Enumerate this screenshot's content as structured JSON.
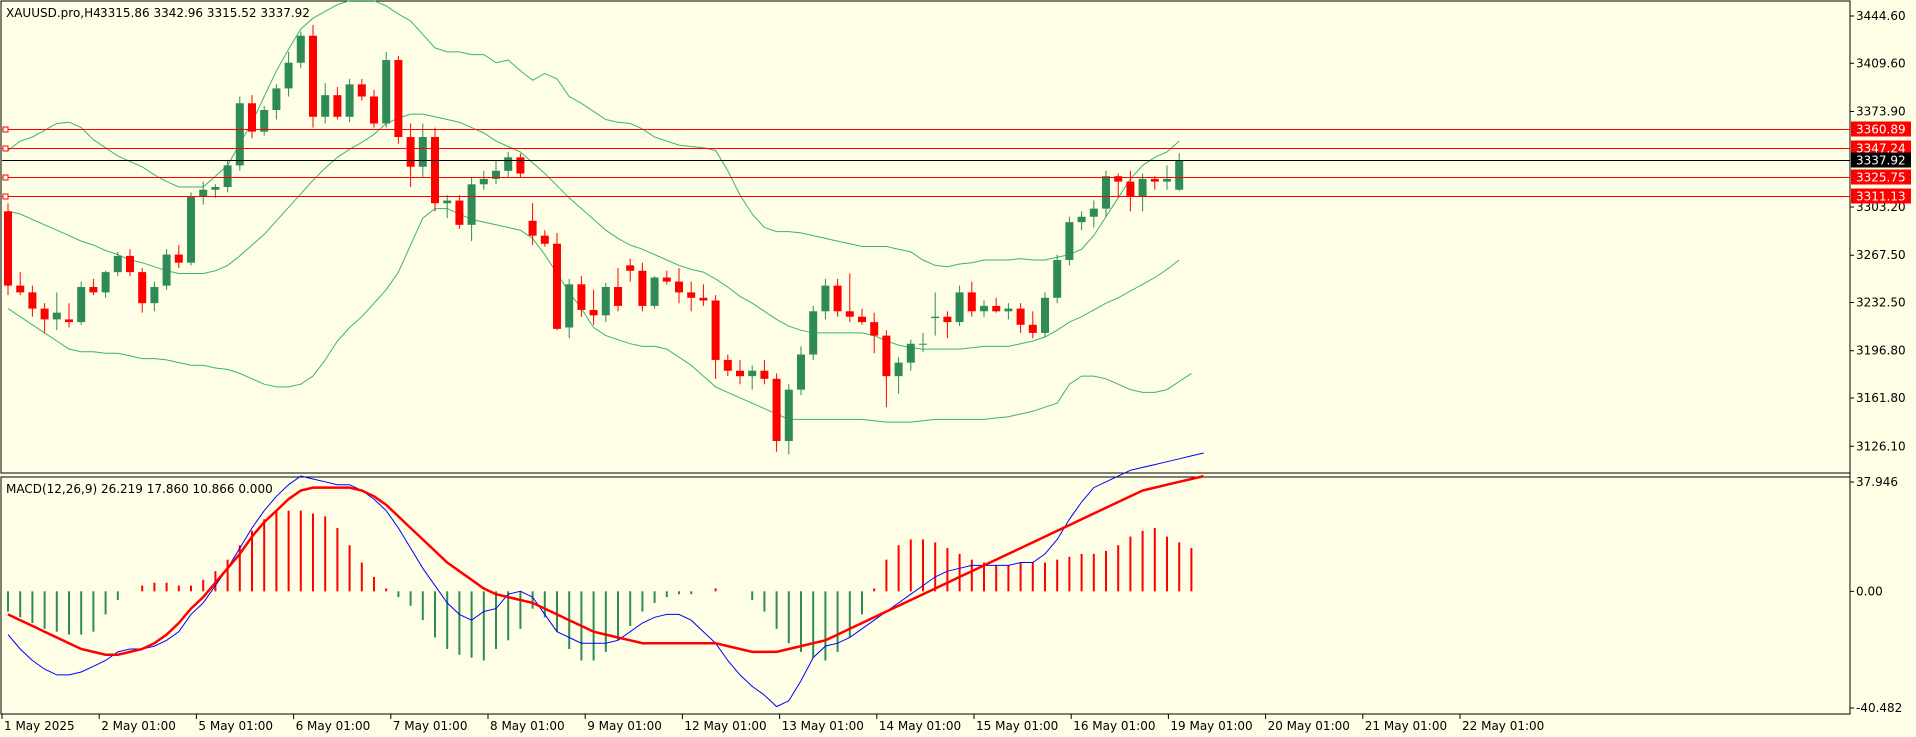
{
  "header": {
    "symbol": "XAUUSD.pro,H4",
    "ohlc": "3315.86 3342.96 3315.52 3337.92"
  },
  "macd_header": "MACD(12,26,9) 26.219 17.860 10.866 0.000",
  "colors": {
    "background": "#fefee6",
    "bull": "#2e8b57",
    "bear": "#ff0000",
    "bollinger": "#3cb371",
    "level": "#ff0000",
    "current": "#000000",
    "macd_line": "#0000ff",
    "signal_line": "#ff0000"
  },
  "chart_data": [
    {
      "type": "candlestick",
      "name": "XAUUSD.pro,H4",
      "ylim": [
        3110,
        3452
      ],
      "price_ticks": [
        "3444.60",
        "3409.60",
        "3373.90",
        "3303.20",
        "3267.50",
        "3232.50",
        "3196.80",
        "3161.80",
        "3126.10"
      ],
      "level_lines": [
        {
          "value": 3360.89,
          "label": "3360.89",
          "color": "#ff0000"
        },
        {
          "value": 3347.24,
          "label": "3347.24",
          "color": "#ff0000"
        },
        {
          "value": 3337.92,
          "label": "3337.92",
          "color": "#000000"
        },
        {
          "value": 3325.75,
          "label": "3325.75",
          "color": "#ff0000"
        },
        {
          "value": 3311.13,
          "label": "3311.13",
          "color": "#ff0000"
        }
      ],
      "x_labels": [
        "1 May 2025",
        "2 May 01:00",
        "5 May 01:00",
        "6 May 01:00",
        "7 May 01:00",
        "8 May 01:00",
        "9 May 01:00",
        "12 May 01:00",
        "13 May 01:00",
        "14 May 01:00",
        "15 May 01:00",
        "16 May 01:00",
        "19 May 01:00",
        "20 May 01:00",
        "21 May 01:00",
        "22 May 01:00"
      ],
      "candles": [
        [
          3300,
          3306,
          3238,
          3245
        ],
        [
          3245,
          3255,
          3238,
          3240
        ],
        [
          3240,
          3245,
          3222,
          3228
        ],
        [
          3228,
          3232,
          3210,
          3220
        ],
        [
          3220,
          3240,
          3212,
          3225
        ],
        [
          3220,
          3232,
          3214,
          3218
        ],
        [
          3218,
          3248,
          3216,
          3244
        ],
        [
          3244,
          3250,
          3238,
          3240
        ],
        [
          3240,
          3256,
          3236,
          3255
        ],
        [
          3255,
          3270,
          3252,
          3267
        ],
        [
          3267,
          3272,
          3252,
          3255
        ],
        [
          3255,
          3258,
          3225,
          3232
        ],
        [
          3232,
          3248,
          3226,
          3244
        ],
        [
          3245,
          3272,
          3242,
          3268
        ],
        [
          3268,
          3275,
          3258,
          3262
        ],
        [
          3262,
          3314,
          3260,
          3311
        ],
        [
          3311,
          3322,
          3305,
          3316
        ],
        [
          3316,
          3320,
          3310,
          3318
        ],
        [
          3318,
          3338,
          3314,
          3334
        ],
        [
          3334,
          3385,
          3330,
          3380
        ],
        [
          3380,
          3386,
          3354,
          3359
        ],
        [
          3359,
          3378,
          3356,
          3375
        ],
        [
          3375,
          3394,
          3368,
          3391
        ],
        [
          3391,
          3418,
          3385,
          3410
        ],
        [
          3410,
          3433,
          3406,
          3430
        ],
        [
          3430,
          3438,
          3362,
          3370
        ],
        [
          3370,
          3395,
          3365,
          3386
        ],
        [
          3386,
          3392,
          3368,
          3370
        ],
        [
          3370,
          3398,
          3366,
          3394
        ],
        [
          3394,
          3398,
          3382,
          3385
        ],
        [
          3385,
          3390,
          3362,
          3365
        ],
        [
          3365,
          3418,
          3362,
          3412
        ],
        [
          3412,
          3415,
          3350,
          3355
        ],
        [
          3355,
          3365,
          3318,
          3333
        ],
        [
          3333,
          3365,
          3325,
          3355
        ],
        [
          3355,
          3362,
          3300,
          3306
        ],
        [
          3306,
          3312,
          3295,
          3308
        ],
        [
          3308,
          3312,
          3287,
          3290
        ],
        [
          3290,
          3325,
          3278,
          3320
        ],
        [
          3320,
          3330,
          3316,
          3324
        ],
        [
          3324,
          3338,
          3320,
          3330
        ],
        [
          3330,
          3344,
          3325,
          3340
        ],
        [
          3340,
          3343,
          3325,
          3328
        ],
        [
          3293,
          3306,
          3275,
          3282
        ],
        [
          3282,
          3286,
          3274,
          3276
        ],
        [
          3276,
          3284,
          3212,
          3213
        ],
        [
          3214,
          3250,
          3206,
          3246
        ],
        [
          3246,
          3252,
          3222,
          3227
        ],
        [
          3227,
          3242,
          3216,
          3223
        ],
        [
          3223,
          3247,
          3218,
          3244
        ],
        [
          3244,
          3258,
          3226,
          3230
        ],
        [
          3260,
          3265,
          3248,
          3256
        ],
        [
          3256,
          3262,
          3226,
          3230
        ],
        [
          3230,
          3252,
          3228,
          3251
        ],
        [
          3251,
          3256,
          3246,
          3248
        ],
        [
          3248,
          3258,
          3232,
          3240
        ],
        [
          3240,
          3248,
          3226,
          3236
        ],
        [
          3236,
          3246,
          3230,
          3234
        ],
        [
          3234,
          3238,
          3176,
          3190
        ],
        [
          3190,
          3194,
          3178,
          3182
        ],
        [
          3182,
          3190,
          3172,
          3178
        ],
        [
          3178,
          3186,
          3168,
          3182
        ],
        [
          3182,
          3190,
          3172,
          3176
        ],
        [
          3176,
          3180,
          3122,
          3130
        ],
        [
          3130,
          3172,
          3120,
          3168
        ],
        [
          3168,
          3200,
          3164,
          3194
        ],
        [
          3194,
          3230,
          3190,
          3226
        ],
        [
          3226,
          3250,
          3220,
          3245
        ],
        [
          3245,
          3250,
          3222,
          3226
        ],
        [
          3226,
          3254,
          3218,
          3222
        ],
        [
          3222,
          3228,
          3216,
          3218
        ],
        [
          3218,
          3225,
          3195,
          3208
        ],
        [
          3208,
          3212,
          3155,
          3178
        ],
        [
          3178,
          3192,
          3165,
          3188
        ],
        [
          3188,
          3205,
          3182,
          3202
        ],
        [
          3202,
          3210,
          3196,
          3202
        ],
        [
          3221,
          3240,
          3208,
          3222
        ],
        [
          3222,
          3226,
          3206,
          3218
        ],
        [
          3218,
          3245,
          3215,
          3240
        ],
        [
          3240,
          3248,
          3222,
          3226
        ],
        [
          3226,
          3234,
          3222,
          3230
        ],
        [
          3230,
          3236,
          3225,
          3226
        ],
        [
          3226,
          3232,
          3220,
          3228
        ],
        [
          3228,
          3232,
          3210,
          3216
        ],
        [
          3216,
          3226,
          3206,
          3210
        ],
        [
          3210,
          3240,
          3207,
          3236
        ],
        [
          3236,
          3268,
          3232,
          3264
        ],
        [
          3264,
          3296,
          3260,
          3292
        ],
        [
          3292,
          3300,
          3286,
          3296
        ],
        [
          3296,
          3308,
          3288,
          3302
        ],
        [
          3302,
          3330,
          3296,
          3326
        ],
        [
          3326,
          3328,
          3310,
          3322
        ],
        [
          3322,
          3330,
          3300,
          3311
        ],
        [
          3311,
          3328,
          3300,
          3324
        ],
        [
          3324,
          3326,
          3316,
          3322
        ],
        [
          3322,
          3334,
          3316,
          3324
        ],
        [
          3316,
          3343,
          3315,
          3338
        ]
      ],
      "bollinger": {
        "upper": [
          3345,
          3352,
          3355,
          3360,
          3365,
          3366,
          3362,
          3353,
          3347,
          3341,
          3337,
          3333,
          3327,
          3322,
          3318,
          3318,
          3318,
          3326,
          3334,
          3350,
          3366,
          3385,
          3404,
          3420,
          3435,
          3443,
          3448,
          3453,
          3456,
          3456,
          3456,
          3452,
          3446,
          3441,
          3431,
          3421,
          3418,
          3418,
          3416,
          3416,
          3410,
          3412,
          3404,
          3397,
          3402,
          3398,
          3385,
          3380,
          3374,
          3368,
          3366,
          3365,
          3361,
          3355,
          3352,
          3349,
          3348,
          3347,
          3345,
          3330,
          3312,
          3298,
          3288,
          3285,
          3285,
          3284,
          3282,
          3280,
          3278,
          3276,
          3274,
          3274,
          3274,
          3272,
          3270,
          3264,
          3260,
          3259,
          3261,
          3262,
          3264,
          3264,
          3264,
          3265,
          3264,
          3264,
          3266,
          3268,
          3272,
          3282,
          3296,
          3310,
          3324,
          3334,
          3340,
          3344,
          3352
        ],
        "middle": [
          3300,
          3298,
          3294,
          3290,
          3286,
          3282,
          3278,
          3275,
          3271,
          3268,
          3264,
          3262,
          3259,
          3256,
          3254,
          3254,
          3254,
          3256,
          3260,
          3267,
          3275,
          3283,
          3293,
          3303,
          3313,
          3323,
          3332,
          3340,
          3346,
          3351,
          3357,
          3365,
          3369,
          3372,
          3372,
          3370,
          3368,
          3366,
          3362,
          3358,
          3352,
          3348,
          3344,
          3336,
          3328,
          3319,
          3310,
          3302,
          3294,
          3286,
          3280,
          3275,
          3272,
          3268,
          3264,
          3260,
          3257,
          3255,
          3250,
          3244,
          3237,
          3232,
          3226,
          3220,
          3215,
          3212,
          3210,
          3210,
          3210,
          3210,
          3210,
          3208,
          3204,
          3201,
          3199,
          3198,
          3198,
          3198,
          3198,
          3199,
          3200,
          3200,
          3200,
          3202,
          3204,
          3207,
          3212,
          3218,
          3222,
          3227,
          3232,
          3236,
          3241,
          3246,
          3251,
          3257,
          3264
        ],
        "lower": [
          3228,
          3222,
          3216,
          3210,
          3204,
          3198,
          3196,
          3196,
          3195,
          3195,
          3193,
          3191,
          3191,
          3190,
          3188,
          3186,
          3186,
          3184,
          3183,
          3180,
          3176,
          3172,
          3170,
          3170,
          3172,
          3178,
          3190,
          3204,
          3214,
          3222,
          3232,
          3242,
          3255,
          3275,
          3295,
          3302,
          3302,
          3298,
          3294,
          3292,
          3290,
          3288,
          3286,
          3280,
          3268,
          3254,
          3240,
          3228,
          3214,
          3208,
          3205,
          3202,
          3200,
          3200,
          3198,
          3192,
          3186,
          3178,
          3170,
          3166,
          3162,
          3158,
          3154,
          3150,
          3146,
          3146,
          3146,
          3146,
          3146,
          3146,
          3146,
          3145,
          3144,
          3144,
          3144,
          3145,
          3146,
          3146,
          3146,
          3146,
          3146,
          3147,
          3148,
          3150,
          3152,
          3155,
          3158,
          3172,
          3178,
          3178,
          3176,
          3172,
          3168,
          3166,
          3166,
          3168,
          3174,
          3180
        ]
      }
    },
    {
      "type": "macd",
      "name": "MACD(12,26,9)",
      "ylim": [
        -40.482,
        37.946
      ],
      "ticks": [
        "37.946",
        "0.00",
        "-40.482"
      ],
      "histogram": [
        -7,
        -9,
        -11,
        -13,
        -14,
        -15,
        -15,
        -14,
        -8,
        -3,
        0,
        2,
        3,
        3,
        2,
        2,
        4,
        7,
        11,
        16,
        21,
        25,
        28,
        28,
        28,
        27,
        26,
        22,
        16,
        10,
        5,
        1,
        -2,
        -5,
        -10,
        -16,
        -20,
        -22,
        -23,
        -24,
        -20,
        -17,
        -13,
        -6,
        -9,
        -14,
        -20,
        -24,
        -24,
        -21,
        -17,
        -12,
        -7,
        -4,
        -2,
        -1,
        -1,
        0,
        1,
        0,
        0,
        -3,
        -7,
        -13,
        -18,
        -21,
        -23,
        -24,
        -21,
        -16,
        -8,
        1,
        11,
        16,
        18,
        18,
        17,
        15,
        13,
        11,
        10,
        9,
        9,
        10,
        10,
        10,
        11,
        12,
        13,
        13,
        14,
        16,
        19,
        21,
        22,
        19,
        17,
        15
      ],
      "macd_line": [
        -15,
        -20,
        -24,
        -27,
        -29,
        -29,
        -28,
        -26,
        -24,
        -21,
        -20,
        -20,
        -19,
        -17,
        -14,
        -8,
        -4,
        2,
        8,
        15,
        22,
        28,
        33,
        37,
        40,
        39,
        38,
        37,
        37,
        35,
        32,
        28,
        22,
        15,
        8,
        2,
        -4,
        -8,
        -10,
        -7,
        -6,
        -1,
        0,
        -2,
        -8,
        -14,
        -16,
        -18,
        -18,
        -18,
        -17,
        -14,
        -11,
        -9,
        -8,
        -8,
        -10,
        -14,
        -18,
        -24,
        -29,
        -33,
        -36,
        -40,
        -38,
        -31,
        -23,
        -19,
        -18,
        -16,
        -13,
        -10,
        -7,
        -4,
        -1,
        2,
        5,
        7,
        8,
        9,
        9,
        9,
        9,
        10,
        10,
        13,
        18,
        25,
        31,
        36,
        38,
        40,
        42,
        43,
        44,
        45,
        46,
        47,
        48
      ],
      "signal_line": [
        -8,
        -10,
        -12,
        -14,
        -16,
        -18,
        -20,
        -21,
        -22,
        -22,
        -21,
        -20,
        -18,
        -15,
        -11,
        -6,
        -2,
        3,
        8,
        13,
        19,
        24,
        28,
        32,
        35,
        36,
        36,
        36,
        36,
        35,
        33,
        30,
        26,
        22,
        18,
        14,
        10,
        7,
        4,
        1,
        -1,
        -2,
        -3,
        -4,
        -6,
        -8,
        -10,
        -12,
        -14,
        -15,
        -16,
        -17,
        -18,
        -18,
        -18,
        -18,
        -18,
        -18,
        -18,
        -19,
        -20,
        -21,
        -21,
        -21,
        -20,
        -19,
        -18,
        -17,
        -15,
        -13,
        -11,
        -9,
        -7,
        -5,
        -3,
        -1,
        1,
        3,
        5,
        7,
        9,
        11,
        13,
        15,
        17,
        19,
        21,
        23,
        25,
        27,
        29,
        31,
        33,
        35,
        36,
        37,
        38,
        39,
        40
      ]
    }
  ]
}
